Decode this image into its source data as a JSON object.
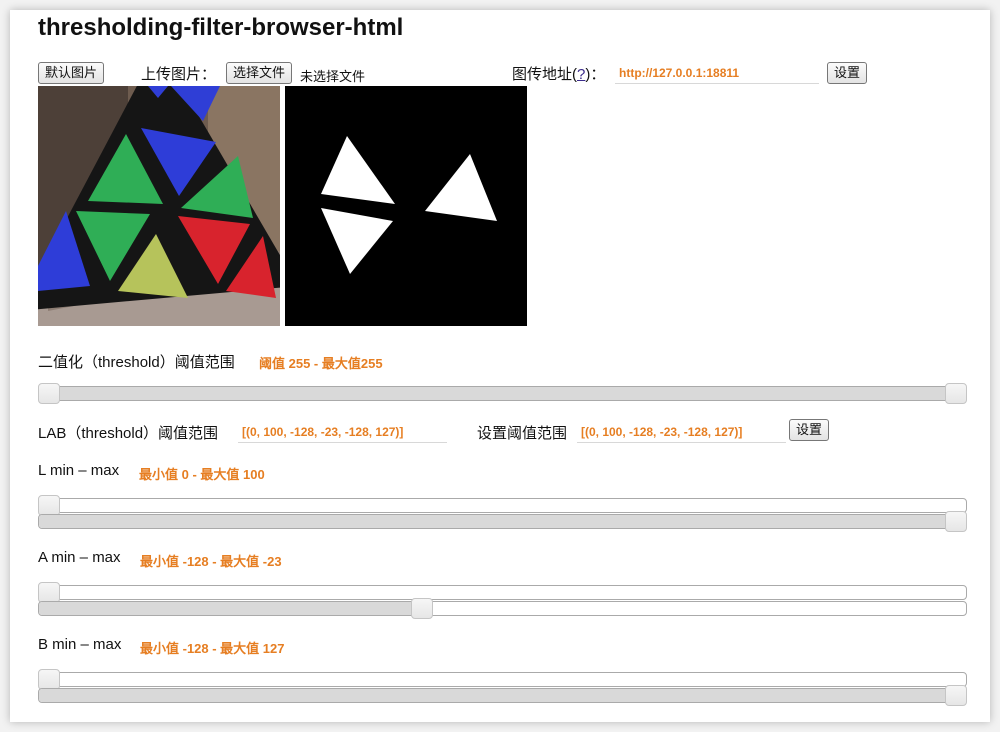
{
  "app": {
    "title": "thresholding-filter-browser-html"
  },
  "toolbar": {
    "default_image_button": "默认图片",
    "upload_label": "上传图片：",
    "choose_file_button": "选择文件",
    "no_file_text": "未选择文件",
    "stream_label": "图传地址(",
    "stream_help": "?",
    "stream_label_end": ")：",
    "stream_url": "http://127.0.0.1:18811",
    "set_button": "设置"
  },
  "threshold": {
    "label": "二值化（threshold）阈值范围",
    "value_text": "阈值 255 - 最大值255",
    "min": 0,
    "max": 255,
    "low": 0,
    "high": 255
  },
  "lab": {
    "label": "LAB（threshold）阈值范围",
    "value": "[(0, 100, -128, -23, -128, 127)]",
    "set_label": "设置阈值范围",
    "set_value": "[(0, 100, -128, -23, -128, 127)]",
    "set_button": "设置"
  },
  "sliders": [
    {
      "name": "L",
      "label": "L min – max",
      "value_text": "最小值 0 - 最大值 100",
      "range_min": 0,
      "range_max": 100,
      "low": 0,
      "high": 100
    },
    {
      "name": "A",
      "label": "A min – max",
      "value_text": "最小值 -128 - 最大值 -23",
      "range_min": -128,
      "range_max": 127,
      "low": -128,
      "high": -23
    },
    {
      "name": "B",
      "label": "B min – max",
      "value_text": "最小值 -128 - 最大值 127",
      "range_min": -128,
      "range_max": 127,
      "low": -128,
      "high": 127
    }
  ],
  "colors": {
    "accent": "#e67e22",
    "page_bg": "#ffffff"
  }
}
